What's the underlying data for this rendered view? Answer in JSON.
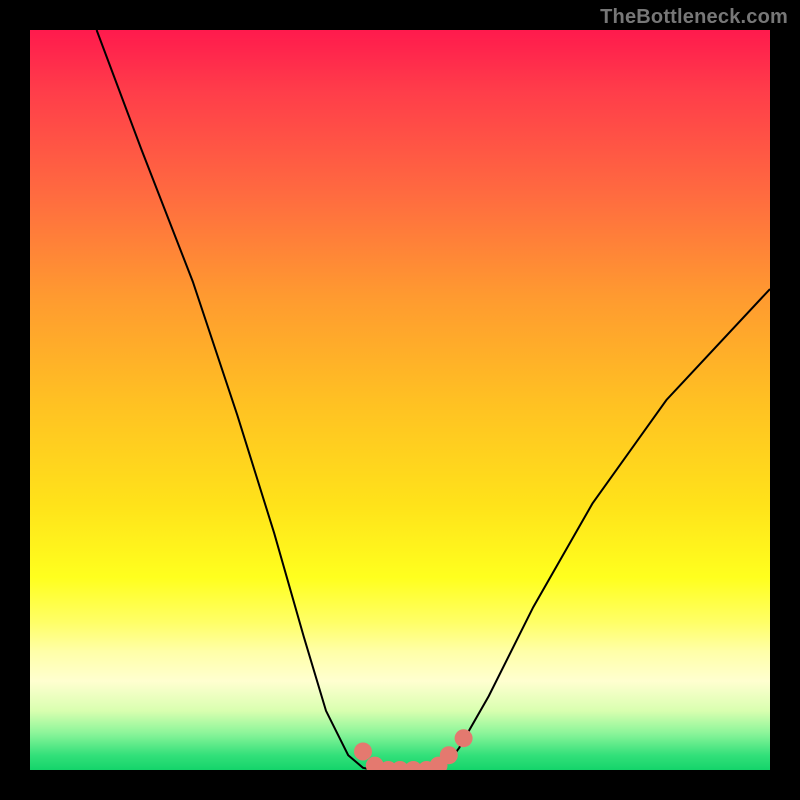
{
  "watermark": "TheBottleneck.com",
  "chart_data": {
    "type": "line",
    "title": "",
    "xlabel": "",
    "ylabel": "",
    "xlim": [
      0,
      100
    ],
    "ylim": [
      0,
      100
    ],
    "series": [
      {
        "name": "curve",
        "x": [
          9,
          15,
          22,
          28,
          33,
          37,
          40,
          43,
          45,
          46.5,
          48,
          50,
          52,
          54,
          56.5,
          58,
          62,
          68,
          76,
          86,
          100
        ],
        "y": [
          100,
          84,
          66,
          48,
          32,
          18,
          8,
          2,
          0.3,
          0,
          0,
          0,
          0,
          0,
          1,
          3,
          10,
          22,
          36,
          50,
          65
        ]
      }
    ],
    "markers": [
      {
        "x": 45.0,
        "y": 2.5
      },
      {
        "x": 46.6,
        "y": 0.6
      },
      {
        "x": 48.4,
        "y": 0.0
      },
      {
        "x": 50.0,
        "y": 0.0
      },
      {
        "x": 51.8,
        "y": 0.0
      },
      {
        "x": 53.6,
        "y": 0.0
      },
      {
        "x": 55.2,
        "y": 0.6
      },
      {
        "x": 56.6,
        "y": 2.0
      },
      {
        "x": 58.6,
        "y": 4.3
      }
    ],
    "colors": {
      "curve": "#000000",
      "markers": "#e4796f"
    }
  }
}
